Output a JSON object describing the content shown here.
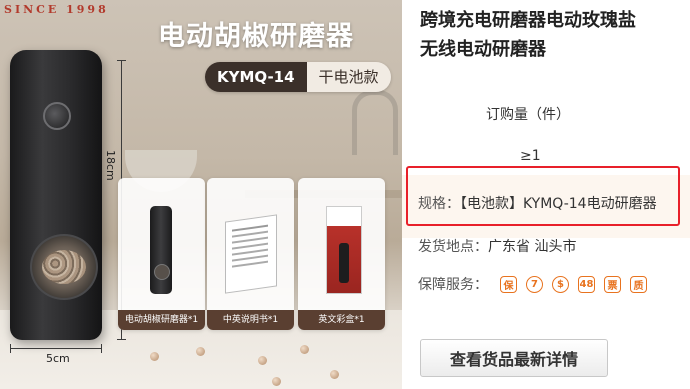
{
  "product_image": {
    "brand_tag": "SINCE 1998",
    "heading": "电动胡椒研磨器",
    "model": "KYMQ-14",
    "model_type": "干电池款",
    "height_dim": "18cm",
    "width_dim": "5cm",
    "package_items": [
      {
        "label": "电动胡椒研磨器*1"
      },
      {
        "label": "中英说明书*1"
      },
      {
        "label": "英文彩盒*1"
      }
    ]
  },
  "info": {
    "title": "跨境充电研磨器电动玫瑰盐\n无线电动研磨器",
    "order_qty_label": "订购量（件）",
    "qty_value": "≥1",
    "spec_label": "规格：",
    "spec_value": "【电池款】KYMQ-14电动研磨器",
    "ship_label": "发货地点：",
    "ship_value": "广东省 汕头市",
    "service_label": "保障服务：",
    "service_icons": [
      {
        "name": "guarantee-icon",
        "glyph": "保"
      },
      {
        "name": "seven-day-return-icon",
        "glyph": "7"
      },
      {
        "name": "fast-ship-icon",
        "glyph": "$"
      },
      {
        "name": "48h-ship-icon",
        "glyph": "48"
      },
      {
        "name": "invoice-icon",
        "glyph": "票"
      },
      {
        "name": "quality-icon",
        "glyph": "质"
      }
    ],
    "details_button": "查看货品最新详情"
  },
  "colors": {
    "highlight_border": "#e8202a",
    "service_orange": "#e8731f",
    "label_brown": "#5a3f31"
  }
}
